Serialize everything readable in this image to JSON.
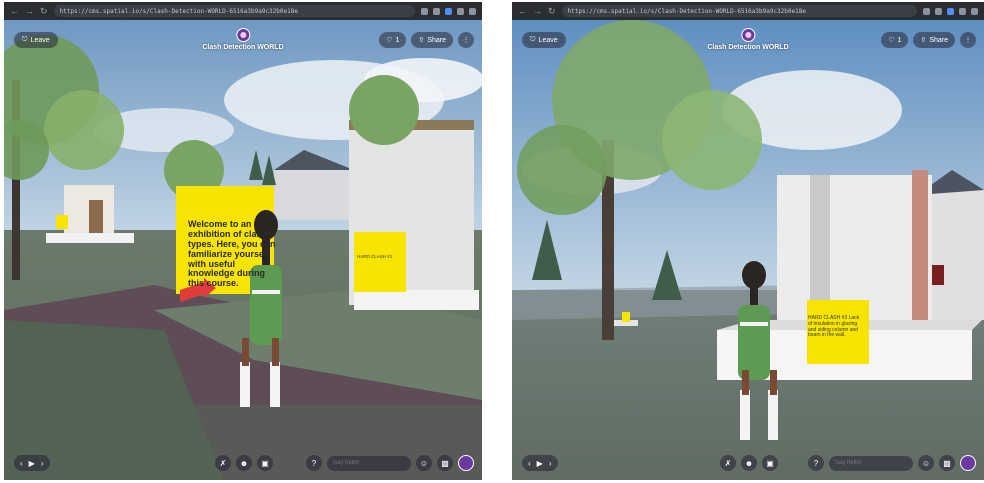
{
  "colors": {
    "sign_yellow": "#f7e400",
    "panel_bg": "#2b2d31",
    "accent_purple": "#6b3aa0"
  },
  "panels": [
    {
      "url": "https://cms.spatial.io/s/Clash-Detection-WORLD-6516a3b9a9c32b0e18e",
      "leave_label": "Leave",
      "world_title": "Clash Detection WORLD",
      "like_count": "1",
      "share_label": "Share",
      "chat_placeholder": "Say hello!",
      "welcome_sign": "Welcome to an exhibition of clash types. Here, you can familiarize yourself with useful knowledge during this course.",
      "small_sign": "HARD CLASH #1"
    },
    {
      "url": "https://cms.spatial.io/s/Clash-Detection-WORLD-6516a3b9a9c32b0e18e",
      "leave_label": "Leave",
      "world_title": "Clash Detection WORLD",
      "like_count": "1",
      "share_label": "Share",
      "chat_placeholder": "Say hello!",
      "small_sign": "HARD CLASH #3 Lack of insulation in glazing and siding column and beam in the wall."
    }
  ]
}
